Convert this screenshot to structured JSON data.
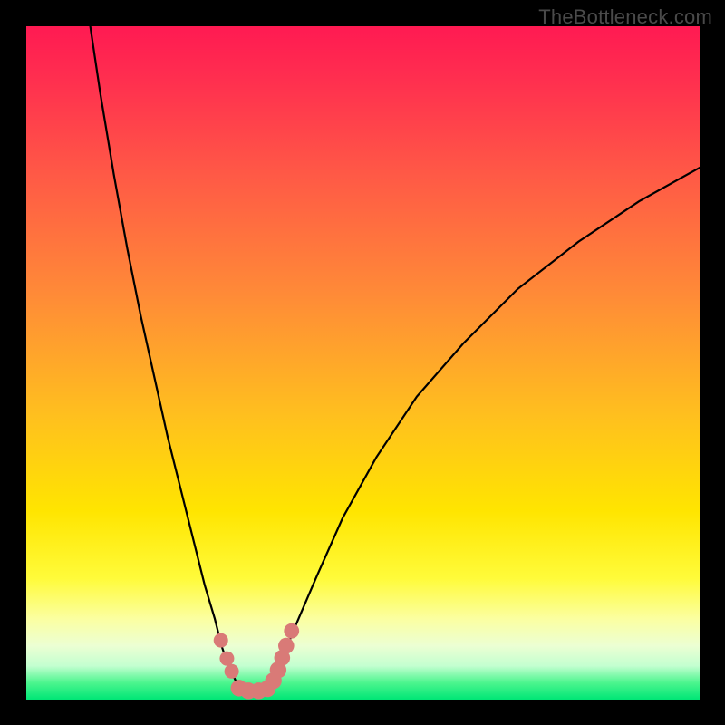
{
  "watermark": "TheBottleneck.com",
  "colors": {
    "frame_bg": "#000000",
    "curve": "#000000",
    "dots": "#d97a77",
    "gradient_top": "#ff1a52",
    "gradient_bottom": "#00e676"
  },
  "chart_data": {
    "type": "line",
    "title": "",
    "xlabel": "",
    "ylabel": "",
    "xlim": [
      0,
      100
    ],
    "ylim": [
      0,
      100
    ],
    "note": "V-shaped bottleneck curve. Values estimated from pixels; no axis ticks shown.",
    "series": [
      {
        "name": "left-branch",
        "x": [
          9.5,
          11,
          13,
          15,
          17,
          19,
          21,
          23,
          25,
          26.5,
          28,
          29,
          30,
          31,
          31.8
        ],
        "y": [
          100,
          90,
          78,
          67,
          57,
          48,
          39,
          31,
          23,
          17,
          12,
          8,
          5,
          3,
          1.5
        ]
      },
      {
        "name": "right-branch",
        "x": [
          36.5,
          38,
          40,
          43,
          47,
          52,
          58,
          65,
          73,
          82,
          91,
          100
        ],
        "y": [
          2,
          6,
          11,
          18,
          27,
          36,
          45,
          53,
          61,
          68,
          74,
          79
        ]
      }
    ],
    "bottom_segment": {
      "name": "valley-floor",
      "x": [
        31.8,
        36.5
      ],
      "y": [
        1.3,
        1.3
      ]
    },
    "dots": {
      "name": "highlight-dots",
      "points": [
        {
          "x": 28.9,
          "y": 8.8,
          "r": 1.0
        },
        {
          "x": 29.8,
          "y": 6.1,
          "r": 1.0
        },
        {
          "x": 30.5,
          "y": 4.2,
          "r": 1.0
        },
        {
          "x": 31.6,
          "y": 1.7,
          "r": 1.3
        },
        {
          "x": 33.0,
          "y": 1.3,
          "r": 1.3
        },
        {
          "x": 34.5,
          "y": 1.3,
          "r": 1.3
        },
        {
          "x": 35.8,
          "y": 1.6,
          "r": 1.3
        },
        {
          "x": 36.7,
          "y": 2.8,
          "r": 1.3
        },
        {
          "x": 37.4,
          "y": 4.4,
          "r": 1.3
        },
        {
          "x": 38.0,
          "y": 6.2,
          "r": 1.2
        },
        {
          "x": 38.6,
          "y": 8.0,
          "r": 1.2
        },
        {
          "x": 39.4,
          "y": 10.2,
          "r": 1.1
        }
      ]
    }
  }
}
